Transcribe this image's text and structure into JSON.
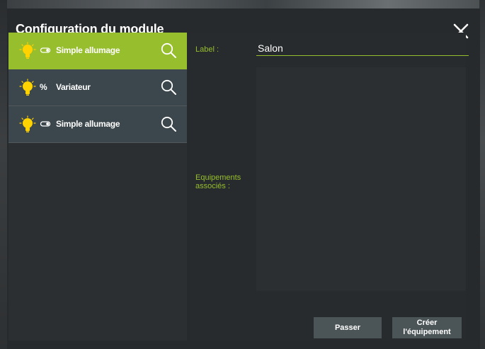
{
  "dialog": {
    "title": "Configuration du module"
  },
  "modules": [
    {
      "label": "Simple allumage",
      "suffix_icon": "toggle-switch-icon",
      "active": true
    },
    {
      "label": "Variateur",
      "suffix_icon": "percent-icon",
      "suffix_text": "%",
      "active": false
    },
    {
      "label": "Simple allumage",
      "suffix_icon": "toggle-switch-icon",
      "active": false
    }
  ],
  "form": {
    "label_caption": "Label :",
    "label_value": "Salon",
    "equipments_caption": "Equipements associés :"
  },
  "buttons": {
    "skip": "Passer",
    "create_line1": "Créer",
    "create_line2": "l'équipement"
  },
  "colors": {
    "accent": "#97be2d",
    "bulb": "#ffd200",
    "item_inactive": "#3b474c",
    "background": "#262a2c"
  }
}
